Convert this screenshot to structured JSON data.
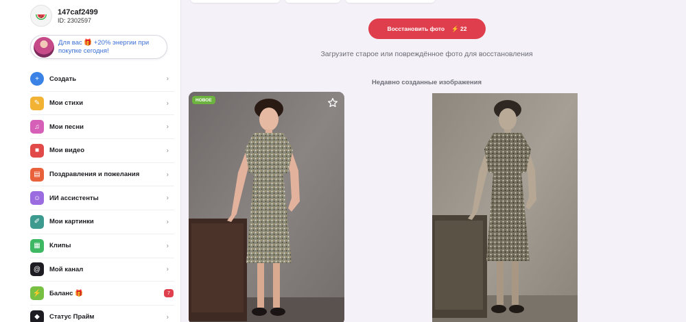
{
  "user": {
    "name": "147caf2499",
    "id": "ID: 2302597"
  },
  "promo": {
    "text": "Для вас 🎁 +20% энергии при покупке сегодня!"
  },
  "menu": {
    "items": [
      {
        "label": "Создать",
        "icon": "plus-icon",
        "color": "#3b82e6",
        "glyph": "+"
      },
      {
        "label": "Мои стихи",
        "icon": "pencil-icon",
        "color": "#f2b233",
        "glyph": "✎"
      },
      {
        "label": "Мои песни",
        "icon": "music-note-icon",
        "color": "#d65fb8",
        "glyph": "♫"
      },
      {
        "label": "Мои видео",
        "icon": "video-camera-icon",
        "color": "#e24a4a",
        "glyph": "■"
      },
      {
        "label": "Поздравления и пожелания",
        "icon": "document-icon",
        "color": "#e8613a",
        "glyph": "▤"
      },
      {
        "label": "ИИ ассистенты",
        "icon": "smiley-icon",
        "color": "#9b6be0",
        "glyph": "☺"
      },
      {
        "label": "Мои картинки",
        "icon": "brush-icon",
        "color": "#3d9a8f",
        "glyph": "✐"
      },
      {
        "label": "Клипы",
        "icon": "film-icon",
        "color": "#3fb864",
        "glyph": "▦"
      },
      {
        "label": "Мой канал",
        "icon": "at-sign-icon",
        "color": "#1c1c22",
        "glyph": "@"
      },
      {
        "label": "Баланс 🎁",
        "icon": "lightning-icon",
        "color": "#77c043",
        "glyph": "⚡",
        "badge": "7"
      },
      {
        "label": "Статус Прайм",
        "icon": "diamond-icon",
        "color": "#1c1c22",
        "glyph": "◆"
      }
    ]
  },
  "main": {
    "restore_button": "Восстановить фото",
    "energy_cost": "⚡ 22",
    "subtitle": "Загрузите старое или повреждённое фото для восстановления",
    "section_title": "Недавно созданные изображения",
    "new_badge": "НОВОЕ"
  },
  "colors": {
    "accent": "#df3f4d",
    "badge_green": "#6db33f",
    "link_blue": "#3b6fd6"
  }
}
